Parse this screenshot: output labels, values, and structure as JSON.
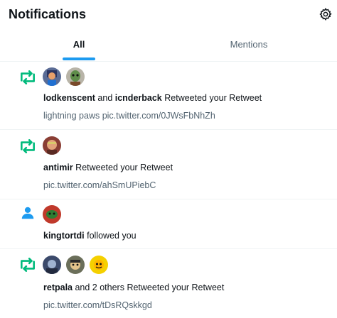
{
  "header": {
    "title": "Notifications",
    "settings_icon": "gear-icon"
  },
  "tabs": [
    {
      "label": "All",
      "selected": true
    },
    {
      "label": "Mentions",
      "selected": false
    }
  ],
  "accent_color": "#1d9bf0",
  "retweet_color": "#00ba7c",
  "notifications": [
    {
      "kind_icon": "retweet-icon",
      "user1": "lodkenscent",
      "joiner": " and ",
      "user2": "icnderback",
      "action": " Retweeted your Retweet",
      "sub_prefix": "lightning paws ",
      "sub_link": "pic.twitter.com/0JWsFbNhZh"
    },
    {
      "kind_icon": "retweet-icon",
      "user1": "antimir",
      "action": " Retweeted your Retweet",
      "sub_link": "pic.twitter.com/ahSmUPiebC"
    },
    {
      "kind_icon": "person-icon",
      "user1": "kingtortdi",
      "action": " followed you"
    },
    {
      "kind_icon": "retweet-icon",
      "user1": "retpala",
      "action": " and 2 others Retweeted your Retweet",
      "sub_link": "pic.twitter.com/tDsRQskkgd"
    }
  ]
}
